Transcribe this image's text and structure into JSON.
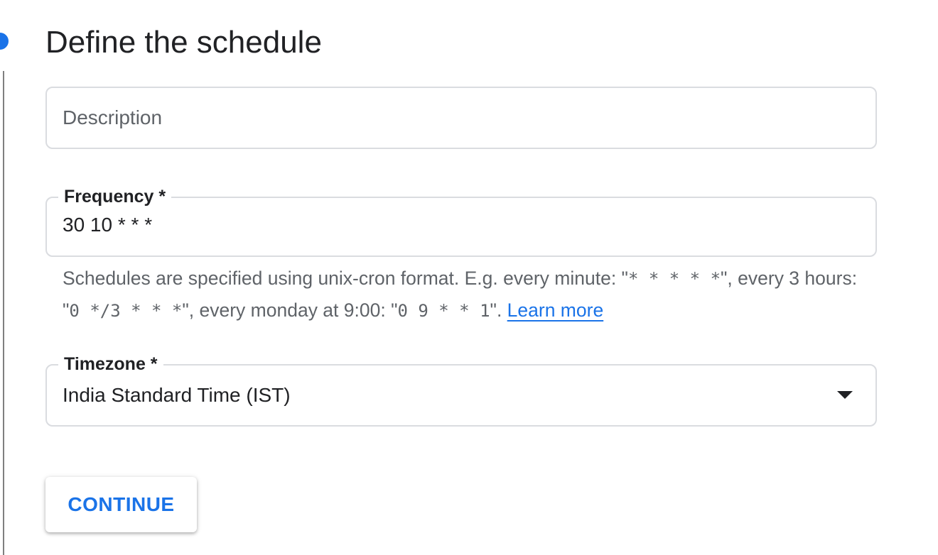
{
  "step": {
    "title": "Define the schedule",
    "indicator_color": "#1a73e8"
  },
  "description_field": {
    "placeholder": "Description",
    "value": ""
  },
  "frequency_field": {
    "label": "Frequency *",
    "value": "30 10 * * *"
  },
  "help": {
    "intro": "Schedules are specified using unix-cron format. E.g. every minute: \"",
    "example_minute": "* * * * *",
    "mid1": "\", every 3 hours: \"",
    "example_hours": "0 */3 * * *",
    "mid2": "\", every monday at 9:00: \"",
    "example_monday": "0 9 * * 1",
    "end": "\". ",
    "learn_more": "Learn more"
  },
  "timezone_field": {
    "label": "Timezone *",
    "selected": "India Standard Time (IST)",
    "icon": "arrow-drop-down-icon"
  },
  "actions": {
    "continue_label": "CONTINUE"
  },
  "colors": {
    "accent": "#1a73e8",
    "text": "#202124",
    "muted": "#5f6368",
    "border": "#dadce0"
  }
}
